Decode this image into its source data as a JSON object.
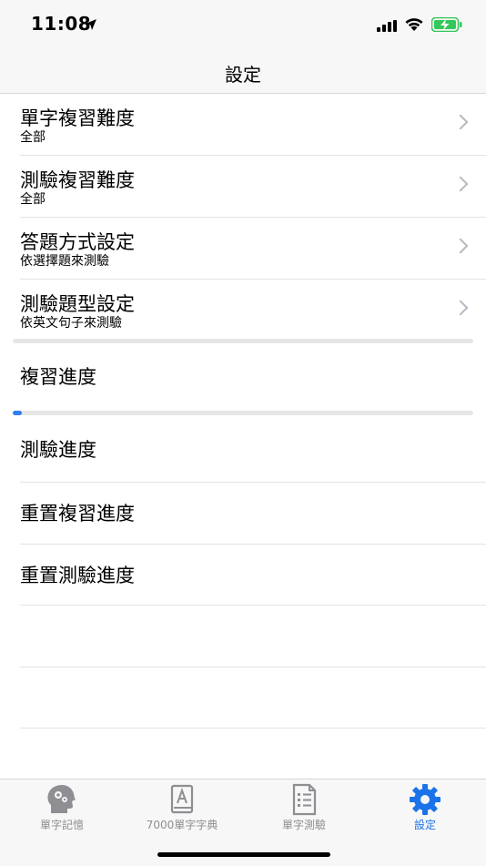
{
  "status_bar": {
    "time": "11:08"
  },
  "nav": {
    "title": "設定"
  },
  "settings": [
    {
      "title": "單字複習難度",
      "subtitle": "全部"
    },
    {
      "title": "測驗複習難度",
      "subtitle": "全部"
    },
    {
      "title": "答題方式設定",
      "subtitle": "依選擇題來測驗"
    },
    {
      "title": "測驗題型設定",
      "subtitle": "依英文句子來測驗"
    }
  ],
  "review_progress": {
    "label": "複習進度",
    "value_percent": 0
  },
  "quiz_progress": {
    "label": "測驗進度",
    "value_percent": 2
  },
  "actions": [
    {
      "label": "重置複習進度"
    },
    {
      "label": "重置測驗進度"
    }
  ],
  "tabs": [
    {
      "label": "單字記憶",
      "icon": "brain-head-icon"
    },
    {
      "label": "7000單字字典",
      "icon": "dictionary-book-icon"
    },
    {
      "label": "單字測驗",
      "icon": "quiz-checklist-icon"
    },
    {
      "label": "設定",
      "icon": "gear-icon",
      "active": true
    }
  ],
  "colors": {
    "accent": "#2f7ff0",
    "tab_active": "#1a73e8",
    "battery": "#34c759"
  }
}
